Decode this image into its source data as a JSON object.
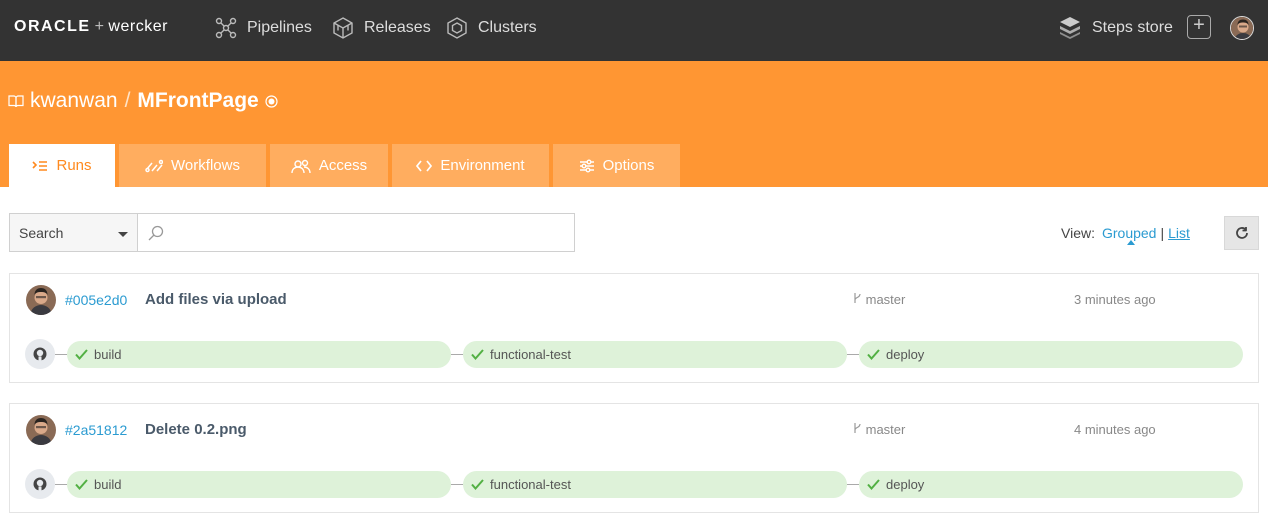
{
  "topnav": {
    "brand_oracle": "ORACLE",
    "brand_plus": "+",
    "brand_wercker": "wercker",
    "items": [
      {
        "label": "Pipelines",
        "icon": "pipelines-icon"
      },
      {
        "label": "Releases",
        "icon": "releases-icon"
      },
      {
        "label": "Clusters",
        "icon": "clusters-icon"
      }
    ],
    "steps_store": "Steps store",
    "plus": "+"
  },
  "header": {
    "owner": "kwanwan",
    "separator": "/",
    "project": "MFrontPage"
  },
  "tabs": [
    {
      "label": "Runs",
      "active": true
    },
    {
      "label": "Workflows",
      "active": false
    },
    {
      "label": "Access",
      "active": false
    },
    {
      "label": "Environment",
      "active": false
    },
    {
      "label": "Options",
      "active": false
    }
  ],
  "filter": {
    "select_value": "Search",
    "search_value": "",
    "search_placeholder": ""
  },
  "view": {
    "label": "View:",
    "grouped": "Grouped",
    "separator": "|",
    "list": "List"
  },
  "runs": [
    {
      "hash": "#005e2d0",
      "message": "Add files via upload",
      "branch": "master",
      "time": "3 minutes ago",
      "steps": [
        "build",
        "functional-test",
        "deploy"
      ]
    },
    {
      "hash": "#2a51812",
      "message": "Delete 0.2.png",
      "branch": "master",
      "time": "4 minutes ago",
      "steps": [
        "build",
        "functional-test",
        "deploy"
      ]
    }
  ],
  "colors": {
    "topbar": "#333333",
    "header": "#ff9633",
    "tab_inactive": "#ffad5f",
    "link": "#2b9bd1",
    "pill": "#def2d9",
    "check": "#52b043"
  }
}
